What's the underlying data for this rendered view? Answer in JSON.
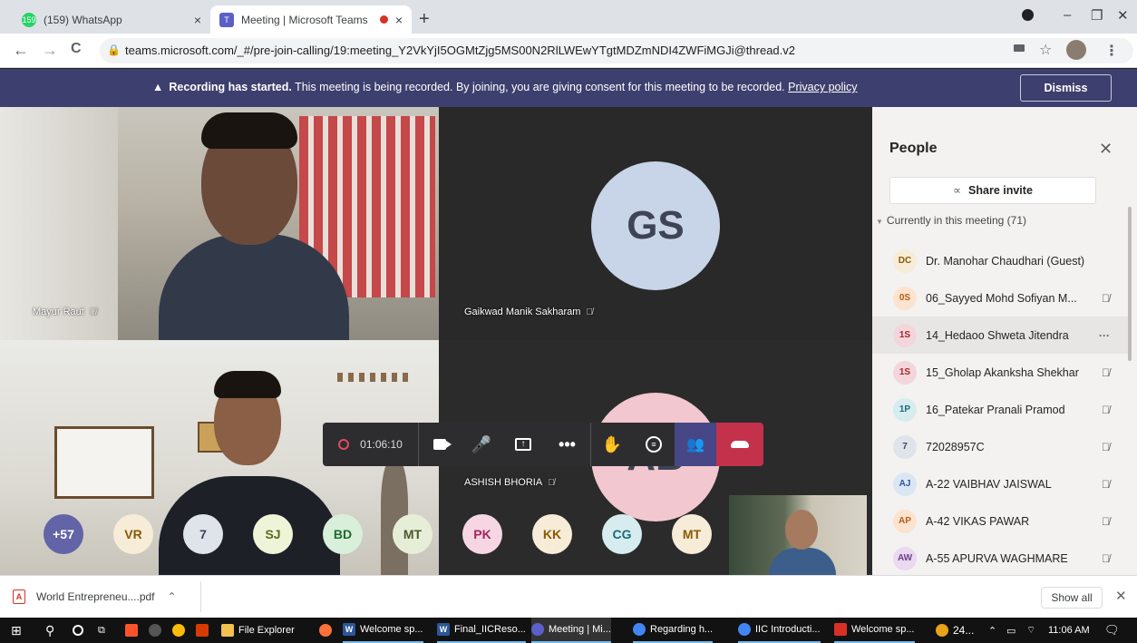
{
  "browser": {
    "tabs": [
      {
        "title": "(159) WhatsApp",
        "badge": "159",
        "close": "×"
      },
      {
        "title": "Meeting | Microsoft Teams",
        "close": "×"
      }
    ],
    "new_tab": "+",
    "url": "teams.microsoft.com/_#/pre-join-calling/19:meeting_Y2VkYjI5OGMtZjg5MS00N2RlLWEwYTgtMDZmNDI4ZWFiMGJi@thread.v2",
    "window_controls": {
      "minimize": "–",
      "maximize": "❐",
      "close": "✕"
    },
    "nav": {
      "back": "←",
      "forward": "→",
      "reload": "C"
    }
  },
  "banner": {
    "icon": "▲",
    "bold": "Recording has started.",
    "text": " This meeting is being recorded. By joining, you are giving consent for this meeting to be recorded. ",
    "link": "Privacy policy",
    "dismiss": "Dismiss"
  },
  "stage": {
    "tiles": [
      {
        "name": "Mayur Raut"
      },
      {
        "name": "Gaikwad Manik Sakharam",
        "initials": "GS"
      },
      {
        "name": ""
      },
      {
        "name": "ASHISH BHORIA",
        "initials": "AB"
      }
    ],
    "roster_circles": [
      "+57",
      "VR",
      "7",
      "SJ",
      "BD",
      "MT",
      "PK",
      "KK",
      "CG",
      "MT"
    ]
  },
  "controls": {
    "timer": "01:06:10"
  },
  "people": {
    "title": "People",
    "share_label": "Share invite",
    "section": "Currently in this meeting (71)",
    "list": [
      {
        "initials": "DC",
        "name": "Dr. Manohar Chaudhari (Guest)",
        "bg": "#f6ecd8",
        "fg": "#8a5a00",
        "mic": ""
      },
      {
        "initials": "0S",
        "name": "06_Sayyed Mohd Sofiyan M...",
        "bg": "#fbe3d0",
        "fg": "#b85c15",
        "mic": "muted"
      },
      {
        "initials": "1S",
        "name": "14_Hedaoo Shweta Jitendra",
        "bg": "#f3d6dc",
        "fg": "#a4262c",
        "mic": "more"
      },
      {
        "initials": "1S",
        "name": "15_Gholap Akanksha Shekhar",
        "bg": "#f3d6dc",
        "fg": "#a4262c",
        "mic": "muted"
      },
      {
        "initials": "1P",
        "name": "16_Patekar Pranali Pramod",
        "bg": "#d6ecef",
        "fg": "#1b6b74",
        "mic": "muted"
      },
      {
        "initials": "7",
        "name": "72028957C",
        "bg": "#dfe3ea",
        "fg": "#3d4456",
        "mic": "muted"
      },
      {
        "initials": "AJ",
        "name": "A-22 VAIBHAV JAISWAL",
        "bg": "#dbe6f5",
        "fg": "#2d5aa1",
        "mic": "muted"
      },
      {
        "initials": "AP",
        "name": "A-42 VIKAS PAWAR",
        "bg": "#fbe3d0",
        "fg": "#b85c15",
        "mic": "muted"
      },
      {
        "initials": "AW",
        "name": "A-55 APURVA WAGHMARE",
        "bg": "#ead9f0",
        "fg": "#6b3f85",
        "mic": "muted"
      }
    ]
  },
  "download": {
    "file": "World Entrepreneu....pdf",
    "show_all": "Show all",
    "close": "✕"
  },
  "taskbar": {
    "items": [
      {
        "label": "File Explorer",
        "color": "#f2c14e"
      },
      {
        "label": "Welcome sp...",
        "color": "#2b579a"
      },
      {
        "label": "Final_IICReso...",
        "color": "#2b579a"
      },
      {
        "label": "Meeting | Mi...",
        "color": "#5b5fc7"
      },
      {
        "label": "Regarding h...",
        "color": "#4285f4"
      },
      {
        "label": "IIC Introducti...",
        "color": "#4285f4"
      },
      {
        "label": "Welcome sp...",
        "color": "#d93025"
      }
    ],
    "weather": "24...",
    "time": "11:06 AM"
  },
  "colors": {
    "banner": "#3d3f6e",
    "people_active": "#474787",
    "hangup": "#c4314b"
  }
}
